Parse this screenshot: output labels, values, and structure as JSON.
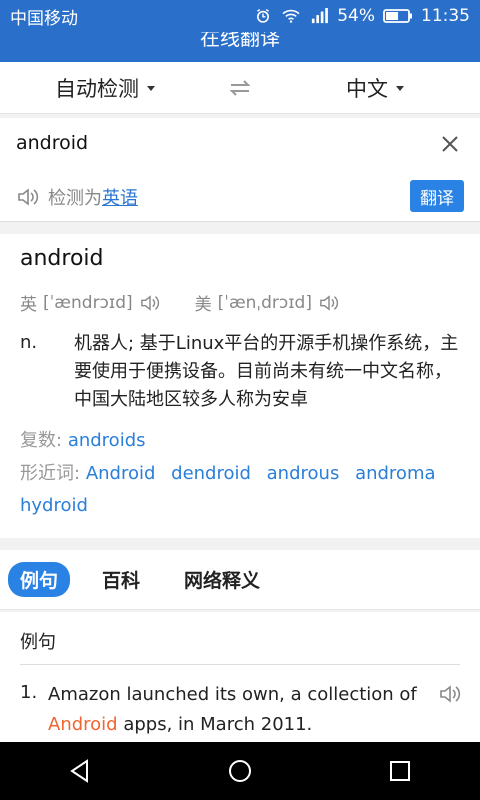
{
  "status": {
    "carrier": "中国移动",
    "battery": "54%",
    "time": "11:35"
  },
  "app": {
    "title": "在线翻译"
  },
  "languages": {
    "source": "自动检测",
    "target": "中文"
  },
  "input": {
    "text": "android",
    "detect_prefix": "检测为",
    "detect_lang": "英语",
    "translate_label": "翻译"
  },
  "result": {
    "word": "android",
    "uk_label": "英",
    "uk_phonetic": "[ˈændrɔɪd]",
    "us_label": "美",
    "us_phonetic": "[ˈænˌdrɔɪd]",
    "pos": "n.",
    "definition": "机器人; 基于Linux平台的开源手机操作系统，主要使用于便携设备。目前尚未有统一中文名称，中国大陆地区较多人称为安卓",
    "plural_label": "复数:",
    "plural": "androids",
    "near_label": "形近词:",
    "near_words": [
      "Android",
      "dendroid",
      "androus",
      "androma",
      "hydroid"
    ]
  },
  "tabs": [
    "例句",
    "百科",
    "网络释义"
  ],
  "examples": {
    "title": "例句",
    "items": [
      {
        "num": "1.",
        "before": "Amazon launched its own, a collection of ",
        "highlight": "Android",
        "after": " apps, in March 2011."
      }
    ]
  },
  "colors": {
    "primary": "#2a82e4",
    "highlight": "#f06530"
  }
}
